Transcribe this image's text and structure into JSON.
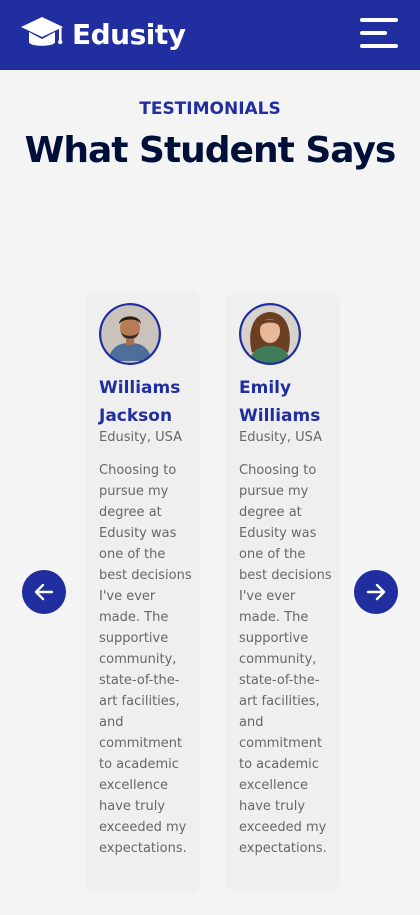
{
  "nav": {
    "brand": "Edusity",
    "logo_icon": "graduation-cap-icon",
    "menu_icon": "hamburger-menu-icon"
  },
  "section": {
    "subtitle": "TESTIMONIALS",
    "title": "What Student Says"
  },
  "testimonials": [
    {
      "name": "Williams Jackson",
      "location": "Edusity, USA",
      "quote": "Choosing to pursue my degree at Edusity was one of the best decisions I've ever made. The supportive community, state-of-the-art facilities, and commitment to academic excellence have truly exceeded my expectations."
    },
    {
      "name": "Emily Williams",
      "location": "Edusity, USA",
      "quote": "Choosing to pursue my degree at Edusity was one of the best decisions I've ever made. The supportive community, state-of-the-art facilities, and commitment to academic excellence have truly exceeded my expectations."
    }
  ],
  "controls": {
    "prev_icon": "arrow-left-icon",
    "next_icon": "arrow-right-icon"
  },
  "colors": {
    "primary": "#212ea0",
    "heading": "#000f38",
    "text_muted": "#676767",
    "background": "#f4f4f4",
    "card": "#efefef"
  }
}
